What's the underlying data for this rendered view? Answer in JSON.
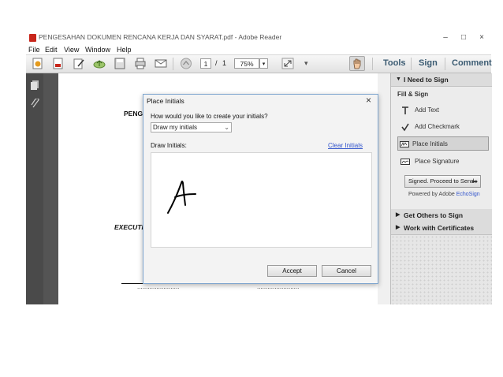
{
  "window": {
    "title": "PENGESAHAN DOKUMEN RENCANA KERJA DAN SYARAT.pdf - Adobe Reader",
    "controls": {
      "minimize": "–",
      "maximize": "□",
      "close": "×"
    }
  },
  "menubar": {
    "items": [
      "File",
      "Edit",
      "View",
      "Window",
      "Help"
    ]
  },
  "toolbar": {
    "page_current": "1",
    "page_sep": "/",
    "page_total": "1",
    "zoom": "75%",
    "tools_label": "Tools",
    "sign_label": "Sign",
    "comment_label": "Comment"
  },
  "document": {
    "heading_fragment": "PENGE",
    "executive_fragment": "EXECUTIV",
    "dots_left": "........................",
    "dots_right": "........................"
  },
  "right_panel": {
    "section_need_sign": "I Need to Sign",
    "fill_sign_title": "Fill & Sign",
    "items": [
      "Add Text",
      "Add Checkmark",
      "Place Initials",
      "Place Signature"
    ],
    "proceed_button": "Signed. Proceed to Send",
    "powered_by": "Powered by Adobe ",
    "powered_brand": "EchoSign",
    "section_others": "Get Others to Sign",
    "section_certs": "Work with Certificates"
  },
  "dialog": {
    "title": "Place Initials",
    "close": "×",
    "question": "How would you like to create your initials?",
    "selected_option": "Draw my initials",
    "draw_label": "Draw Initials:",
    "clear_link": "Clear Initials",
    "accept_button": "Accept",
    "cancel_button": "Cancel"
  },
  "colors": {
    "accent_link": "#3355cc",
    "tab_text": "#3b5b72",
    "dialog_border": "#7fa6cf"
  }
}
